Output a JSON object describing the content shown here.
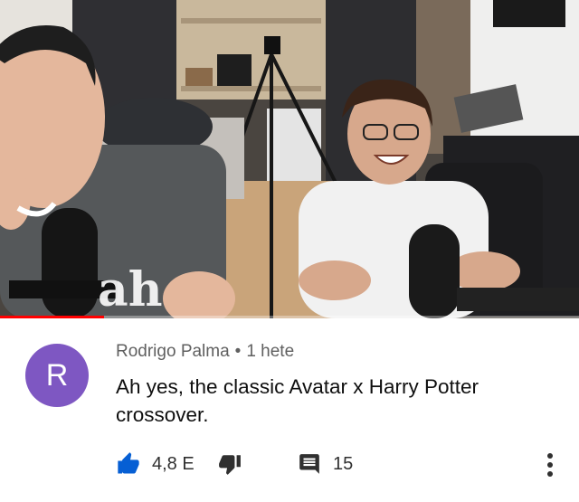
{
  "video": {
    "watermark_text": "ah",
    "progress_fraction": 0.18
  },
  "comment": {
    "avatar_initial": "R",
    "author": "Rodrigo Palma",
    "separator": "•",
    "time": "1 hete",
    "text": "Ah yes, the classic Avatar x Harry Potter crossover.",
    "like_count": "4,8 E",
    "reply_count": "15"
  },
  "icons": {
    "like": "thumbs-up-icon",
    "dislike": "thumbs-down-icon",
    "reply": "comment-icon",
    "more": "more-vertical-icon"
  },
  "colors": {
    "avatar_bg": "#7e57c2",
    "like_active": "#065fd4",
    "progress": "#ff0000"
  }
}
